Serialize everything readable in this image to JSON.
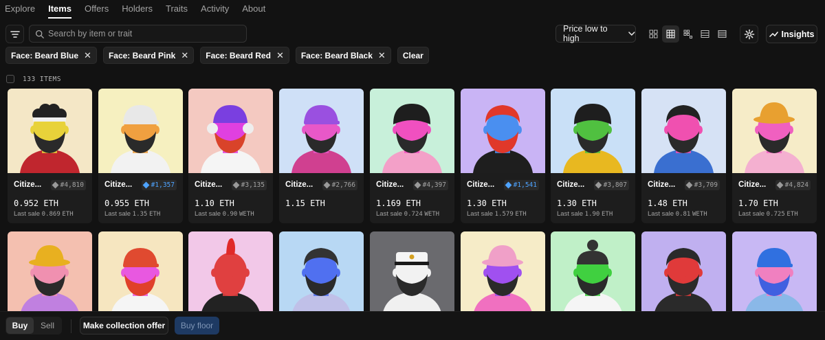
{
  "nav": {
    "tabs": [
      {
        "label": "Explore",
        "active": false
      },
      {
        "label": "Items",
        "active": true
      },
      {
        "label": "Offers",
        "active": false
      },
      {
        "label": "Holders",
        "active": false
      },
      {
        "label": "Traits",
        "active": false
      },
      {
        "label": "Activity",
        "active": false
      },
      {
        "label": "About",
        "active": false
      }
    ]
  },
  "toolbar": {
    "filter_icon": "filter-lines-icon",
    "search_placeholder": "Search by item or trait",
    "sort_label": "Price low to high",
    "view_modes": [
      "grid-large-icon",
      "grid-medium-icon",
      "grid-small-icon",
      "list-rows-icon",
      "table-icon"
    ],
    "active_view": 1,
    "settings_icon": "gear-icon",
    "insights_label": "Insights"
  },
  "filters": {
    "chips": [
      "Face: Beard Blue",
      "Face: Beard Pink",
      "Face: Beard Red",
      "Face: Beard Black"
    ],
    "clear_label": "Clear"
  },
  "results": {
    "count_label": "133 ITEMS"
  },
  "items": [
    {
      "name": "Citize...",
      "token": "#4,810",
      "tag_color": "gray",
      "price": "0.952",
      "currency": "ETH",
      "last_sale_label": "Last sale",
      "last_sale": "0.869",
      "last_currency": "ETH",
      "bg": "#f4e7c6",
      "skin": "#e8d23a",
      "beard": "#2a2a2a",
      "hat": "curly",
      "hat_color": "#222222",
      "shirt": "#c0262e"
    },
    {
      "name": "Citize...",
      "token": "#1,357",
      "tag_color": "blue",
      "price": "0.955",
      "currency": "ETH",
      "last_sale_label": "Last sale",
      "last_sale": "1.35",
      "last_currency": "ETH",
      "bg": "#f6f0c0",
      "skin": "#f0a040",
      "beard": "#2a2a2a",
      "hat": "cap",
      "hat_color": "#e8e8e8",
      "shirt": "#f2f2f2"
    },
    {
      "name": "Citize...",
      "token": "#3,135",
      "tag_color": "gray",
      "price": "1.10",
      "currency": "ETH",
      "last_sale_label": "Last sale",
      "last_sale": "0.90",
      "last_currency": "WETH",
      "bg": "#f4c9c1",
      "skin": "#e040e0",
      "beard": "#d9432a",
      "hat": "headphones",
      "hat_color": "#7a3fe0",
      "shirt": "#f5f5f5"
    },
    {
      "name": "Citize...",
      "token": "#2,766",
      "tag_color": "gray",
      "price": "1.15",
      "currency": "ETH",
      "last_sale_label": "",
      "last_sale": "",
      "last_currency": "",
      "bg": "#cfe0f7",
      "skin": "#e858c8",
      "beard": "#2a2a2a",
      "hat": "cap",
      "hat_color": "#9a50e0",
      "shirt": "#d04090"
    },
    {
      "name": "Citize...",
      "token": "#4,397",
      "tag_color": "gray",
      "price": "1.169",
      "currency": "ETH",
      "last_sale_label": "Last sale",
      "last_sale": "0.724",
      "last_currency": "WETH",
      "bg": "#c8f0da",
      "skin": "#f050c0",
      "beard": "#2a2a2a",
      "hat": "bowl",
      "hat_color": "#1e1e1e",
      "shirt": "#f3a0c8"
    },
    {
      "name": "Citize...",
      "token": "#1,541",
      "tag_color": "blue",
      "price": "1.30",
      "currency": "ETH",
      "last_sale_label": "Last sale",
      "last_sale": "1.579",
      "last_currency": "ETH",
      "bg": "#c9b4f5",
      "skin": "#4a8ff0",
      "beard": "#e0382a",
      "hat": "hair",
      "hat_color": "#e0382a",
      "shirt": "#1e1e1e"
    },
    {
      "name": "Citize...",
      "token": "#3,807",
      "tag_color": "gray",
      "price": "1.30",
      "currency": "ETH",
      "last_sale_label": "Last sale",
      "last_sale": "1.90",
      "last_currency": "ETH",
      "bg": "#c9e0f7",
      "skin": "#50c040",
      "beard": "#2a2a2a",
      "hat": "bowl",
      "hat_color": "#1e1e1e",
      "shirt": "#e8b820"
    },
    {
      "name": "Citize...",
      "token": "#3,709",
      "tag_color": "gray",
      "price": "1.48",
      "currency": "ETH",
      "last_sale_label": "Last sale",
      "last_sale": "0.81",
      "last_currency": "WETH",
      "bg": "#d6e2f5",
      "skin": "#f050b0",
      "beard": "#2a2a2a",
      "hat": "hair",
      "hat_color": "#222222",
      "shirt": "#3a6fd0"
    },
    {
      "name": "Citize...",
      "token": "#4,824",
      "tag_color": "gray",
      "price": "1.70",
      "currency": "ETH",
      "last_sale_label": "Last sale",
      "last_sale": "0.725",
      "last_currency": "ETH",
      "bg": "#f6ecc8",
      "skin": "#f060c0",
      "beard": "#2a2a2a",
      "hat": "bucket",
      "hat_color": "#e8a030",
      "shirt": "#f4b0d0"
    },
    {
      "bg": "#f4c0b0",
      "skin": "#f090b0",
      "beard": "#2a2a2a",
      "hat": "bucket",
      "hat_color": "#e8b020",
      "shirt": "#c080e0"
    },
    {
      "bg": "#f6e6c0",
      "skin": "#e858e0",
      "beard": "#e0402a",
      "hat": "cap",
      "hat_color": "#e04a30",
      "shirt": "#f5f5f5"
    },
    {
      "bg": "#f2c8e8",
      "skin": "#e04040",
      "beard": "#e04040",
      "hat": "mohawk",
      "hat_color": "#e02a2a",
      "shirt": "#222222"
    },
    {
      "bg": "#b8d8f4",
      "skin": "#5070f0",
      "beard": "#2a2a2a",
      "hat": "hair",
      "hat_color": "#333333",
      "shirt": "#c0c0e8"
    },
    {
      "bg": "#6a6a6e",
      "skin": "#f2f2f2",
      "beard": "#2a2a2a",
      "hat": "captain",
      "hat_color": "#f5f5f5",
      "shirt": "#f0f0f0"
    },
    {
      "bg": "#f6ecc8",
      "skin": "#a050f0",
      "beard": "#2a2a2a",
      "hat": "bucket",
      "hat_color": "#f0a0c8",
      "shirt": "#f070c0"
    },
    {
      "bg": "#c0f0c8",
      "skin": "#40d040",
      "beard": "#2a2a2a",
      "hat": "bun",
      "hat_color": "#333333",
      "shirt": "#f5f5f5"
    },
    {
      "bg": "#c0b0f0",
      "skin": "#e03a3a",
      "beard": "#2a2a2a",
      "hat": "hair",
      "hat_color": "#2a2a2a",
      "shirt": "#2a2a2a"
    },
    {
      "bg": "#c8b8f4",
      "skin": "#f080c0",
      "beard": "#4060e0",
      "hat": "cap",
      "hat_color": "#3070e0",
      "shirt": "#8ab8e8"
    }
  ],
  "bottom": {
    "buy_label": "Buy",
    "sell_label": "Sell",
    "collection_offer_label": "Make collection offer",
    "buy_floor_label": "Buy floor"
  }
}
